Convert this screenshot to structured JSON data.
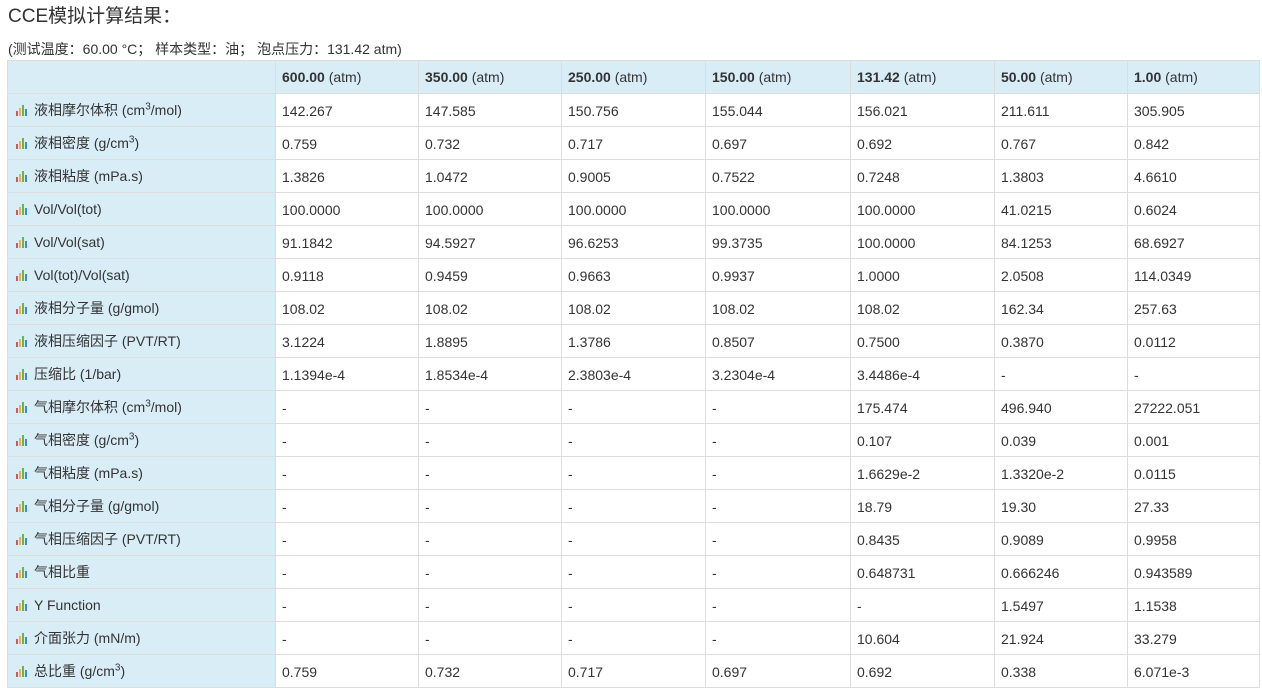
{
  "title": "CCE模拟计算结果：",
  "subtitle": "(测试温度：60.00 °C； 样本类型：油； 泡点压力：131.42 atm)",
  "table": {
    "columns": [
      {
        "value": "600.00",
        "unit": "(atm)"
      },
      {
        "value": "350.00",
        "unit": "(atm)"
      },
      {
        "value": "250.00",
        "unit": "(atm)"
      },
      {
        "value": "150.00",
        "unit": "(atm)"
      },
      {
        "value": "131.42",
        "unit": "(atm)"
      },
      {
        "value": "50.00",
        "unit": "(atm)"
      },
      {
        "value": "1.00",
        "unit": "(atm)"
      }
    ],
    "rows": [
      {
        "pre": "液相摩尔体积 (cm",
        "sup": "3",
        "post": "/mol)",
        "values": [
          "142.267",
          "147.585",
          "150.756",
          "155.044",
          "156.021",
          "211.611",
          "305.905"
        ]
      },
      {
        "pre": "液相密度 (g/cm",
        "sup": "3",
        "post": ")",
        "values": [
          "0.759",
          "0.732",
          "0.717",
          "0.697",
          "0.692",
          "0.767",
          "0.842"
        ]
      },
      {
        "pre": "液相粘度 (mPa.s)",
        "sup": "",
        "post": "",
        "values": [
          "1.3826",
          "1.0472",
          "0.9005",
          "0.7522",
          "0.7248",
          "1.3803",
          "4.6610"
        ]
      },
      {
        "pre": "Vol/Vol(tot)",
        "sup": "",
        "post": "",
        "values": [
          "100.0000",
          "100.0000",
          "100.0000",
          "100.0000",
          "100.0000",
          "41.0215",
          "0.6024"
        ]
      },
      {
        "pre": "Vol/Vol(sat)",
        "sup": "",
        "post": "",
        "values": [
          "91.1842",
          "94.5927",
          "96.6253",
          "99.3735",
          "100.0000",
          "84.1253",
          "68.6927"
        ]
      },
      {
        "pre": "Vol(tot)/Vol(sat)",
        "sup": "",
        "post": "",
        "values": [
          "0.9118",
          "0.9459",
          "0.9663",
          "0.9937",
          "1.0000",
          "2.0508",
          "114.0349"
        ]
      },
      {
        "pre": "液相分子量 (g/gmol)",
        "sup": "",
        "post": "",
        "values": [
          "108.02",
          "108.02",
          "108.02",
          "108.02",
          "108.02",
          "162.34",
          "257.63"
        ]
      },
      {
        "pre": "液相压缩因子 (PVT/RT)",
        "sup": "",
        "post": "",
        "values": [
          "3.1224",
          "1.8895",
          "1.3786",
          "0.8507",
          "0.7500",
          "0.3870",
          "0.0112"
        ]
      },
      {
        "pre": "压缩比 (1/bar)",
        "sup": "",
        "post": "",
        "values": [
          "1.1394e-4",
          "1.8534e-4",
          "2.3803e-4",
          "3.2304e-4",
          "3.4486e-4",
          "-",
          "-"
        ]
      },
      {
        "pre": "气相摩尔体积 (cm",
        "sup": "3",
        "post": "/mol)",
        "values": [
          "-",
          "-",
          "-",
          "-",
          "175.474",
          "496.940",
          "27222.051"
        ]
      },
      {
        "pre": "气相密度 (g/cm",
        "sup": "3",
        "post": ")",
        "values": [
          "-",
          "-",
          "-",
          "-",
          "0.107",
          "0.039",
          "0.001"
        ]
      },
      {
        "pre": "气相粘度 (mPa.s)",
        "sup": "",
        "post": "",
        "values": [
          "-",
          "-",
          "-",
          "-",
          "1.6629e-2",
          "1.3320e-2",
          "0.0115"
        ]
      },
      {
        "pre": "气相分子量 (g/gmol)",
        "sup": "",
        "post": "",
        "values": [
          "-",
          "-",
          "-",
          "-",
          "18.79",
          "19.30",
          "27.33"
        ]
      },
      {
        "pre": "气相压缩因子 (PVT/RT)",
        "sup": "",
        "post": "",
        "values": [
          "-",
          "-",
          "-",
          "-",
          "0.8435",
          "0.9089",
          "0.9958"
        ]
      },
      {
        "pre": "气相比重",
        "sup": "",
        "post": "",
        "values": [
          "-",
          "-",
          "-",
          "-",
          "0.648731",
          "0.666246",
          "0.943589"
        ]
      },
      {
        "pre": "Y Function",
        "sup": "",
        "post": "",
        "values": [
          "-",
          "-",
          "-",
          "-",
          "-",
          "1.5497",
          "1.1538"
        ]
      },
      {
        "pre": "介面张力 (mN/m)",
        "sup": "",
        "post": "",
        "values": [
          "-",
          "-",
          "-",
          "-",
          "10.604",
          "21.924",
          "33.279"
        ]
      },
      {
        "pre": "总比重 (g/cm",
        "sup": "3",
        "post": ")",
        "values": [
          "0.759",
          "0.732",
          "0.717",
          "0.697",
          "0.692",
          "0.338",
          "6.071e-3"
        ]
      }
    ]
  }
}
